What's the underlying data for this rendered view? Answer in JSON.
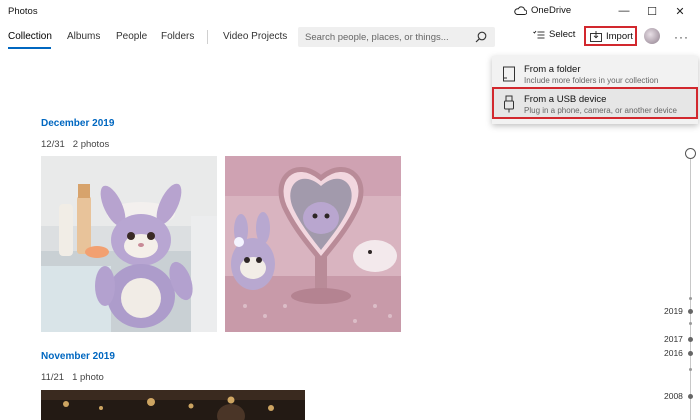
{
  "window": {
    "title": "Photos",
    "onedrive_label": "OneDrive",
    "minimize": "—",
    "maximize": "☐",
    "close": "✕"
  },
  "nav": {
    "tabs": [
      {
        "label": "Collection",
        "active": true
      },
      {
        "label": "Albums"
      },
      {
        "label": "People"
      },
      {
        "label": "Folders"
      },
      {
        "label": "Video Projects"
      }
    ],
    "search_placeholder": "Search people, places, or things...",
    "select_label": "Select",
    "import_label": "Import",
    "more": "···"
  },
  "import_menu": {
    "items": [
      {
        "title": "From a folder",
        "subtitle": "Include more folders in your collection",
        "icon": "folder-icon"
      },
      {
        "title": "From a USB device",
        "subtitle": "Plug in a phone, camera, or another device",
        "icon": "usb-icon",
        "highlighted": true
      }
    ]
  },
  "collection": {
    "groups": [
      {
        "month": "December 2019",
        "date": "12/31",
        "count": "2 photos"
      },
      {
        "month": "November 2019",
        "date": "11/21",
        "count": "1 photo"
      }
    ]
  },
  "timeline": {
    "years": [
      "2019",
      "2017",
      "2016",
      "2008"
    ]
  },
  "colors": {
    "accent": "#0067c0",
    "highlight_border": "#d2282e"
  }
}
